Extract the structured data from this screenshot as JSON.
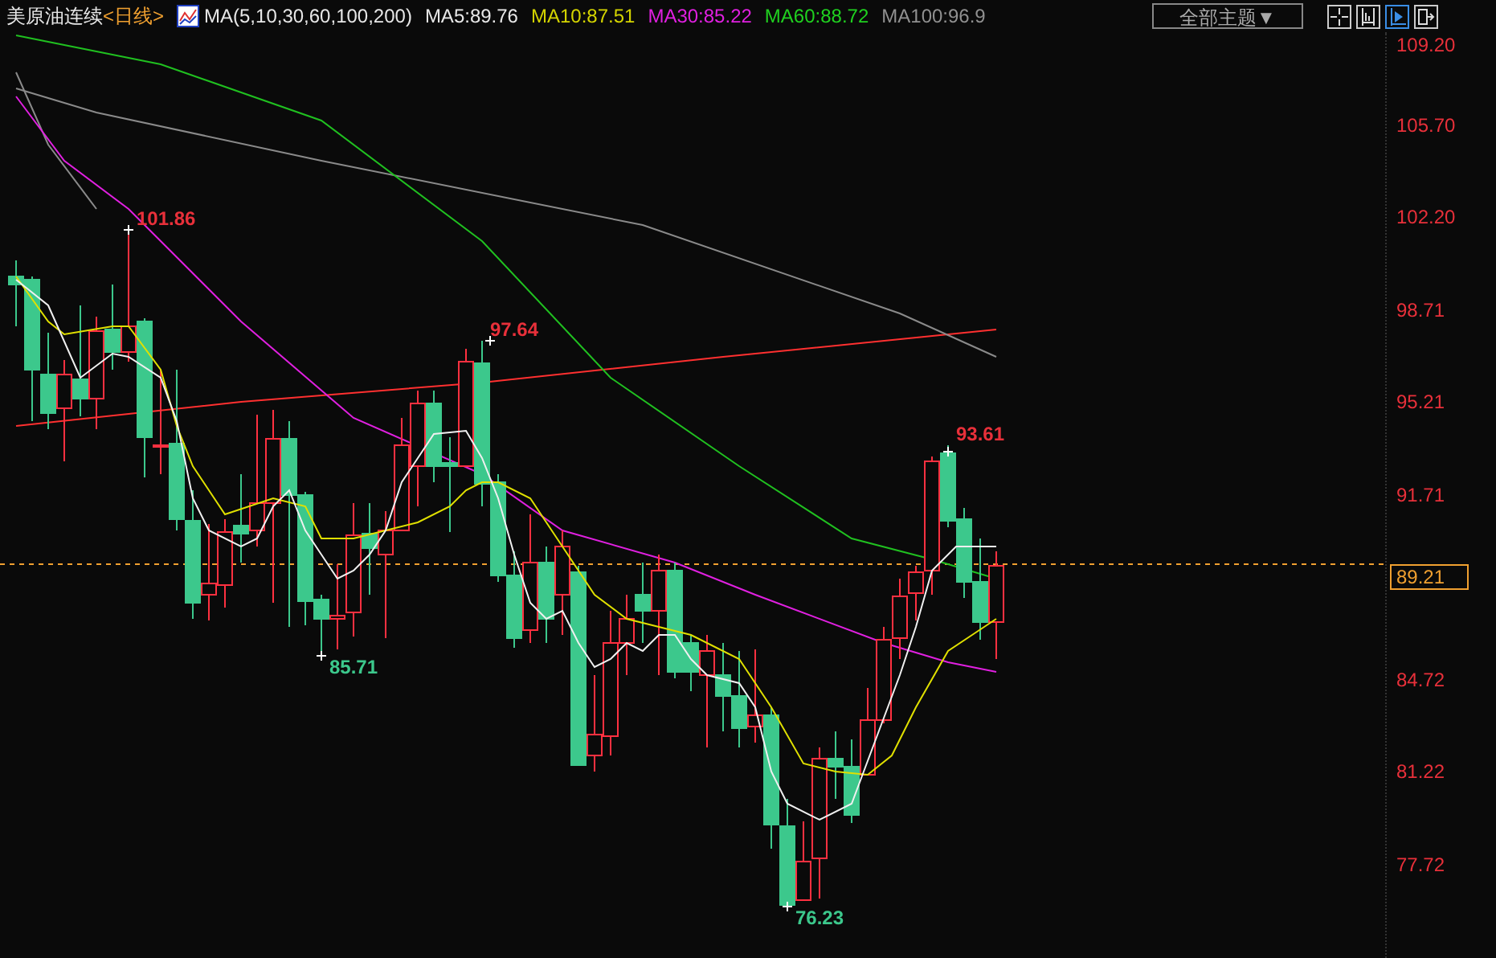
{
  "header": {
    "instrument": "美原油连续",
    "period": "<日线>",
    "indicator": "MA(5,10,30,60,100,200)",
    "ma_values": [
      {
        "label": "MA5:89.76",
        "color": "#e8e8e8"
      },
      {
        "label": "MA10:87.51",
        "color": "#d4d400"
      },
      {
        "label": "MA30:85.22",
        "color": "#e020e0"
      },
      {
        "label": "MA60:88.72",
        "color": "#20d020"
      },
      {
        "label": "MA100:96.9",
        "color": "#909090"
      }
    ]
  },
  "theme_select": {
    "value": "全部主题▼"
  },
  "toolbar_buttons": [
    {
      "kind": "crosshair",
      "selected": false
    },
    {
      "kind": "range",
      "selected": false
    },
    {
      "kind": "play",
      "selected": true
    },
    {
      "kind": "exit",
      "selected": false
    }
  ],
  "price_axis": [
    "109.20",
    "105.70",
    "102.20",
    "98.71",
    "95.21",
    "91.71",
    "84.72",
    "81.22",
    "77.72"
  ],
  "current_price": "89.21",
  "annotations": [
    {
      "text": "101.86",
      "kind": "high"
    },
    {
      "text": "97.64",
      "kind": "high"
    },
    {
      "text": "85.71",
      "kind": "low"
    },
    {
      "text": "76.23",
      "kind": "low"
    },
    {
      "text": "93.61",
      "kind": "high"
    }
  ]
}
